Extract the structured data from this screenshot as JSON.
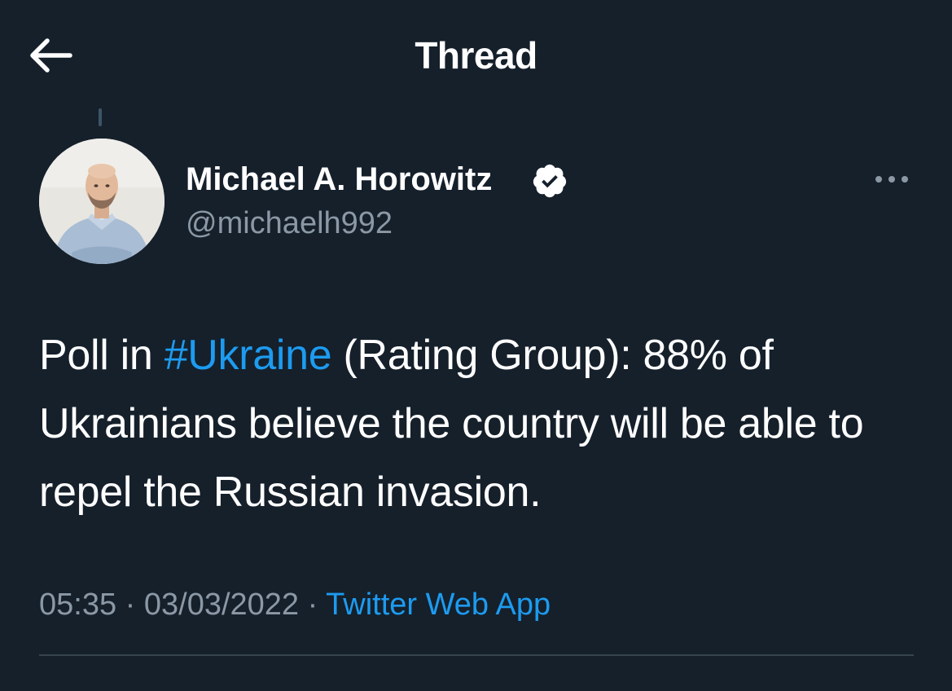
{
  "header": {
    "title": "Thread",
    "back_icon": "arrow-left-icon"
  },
  "tweet": {
    "author": {
      "name": "Michael A. Horowitz",
      "handle": "@michaelh992",
      "verified": true,
      "avatar_icon": "profile-photo"
    },
    "more_icon": "more-horizontal-icon",
    "text_before": "Poll in ",
    "hashtag": "#Ukraine",
    "text_after": " (Rating Group): 88% of Ukrainians believe the country will be able to repel the Russian invasion.",
    "time": "05:35",
    "date": "03/03/2022",
    "separator": "·",
    "source": "Twitter Web App"
  },
  "colors": {
    "background": "#15202b",
    "accent": "#1d9bf0",
    "secondary_text": "#8b98a5",
    "divider": "#38444d"
  }
}
